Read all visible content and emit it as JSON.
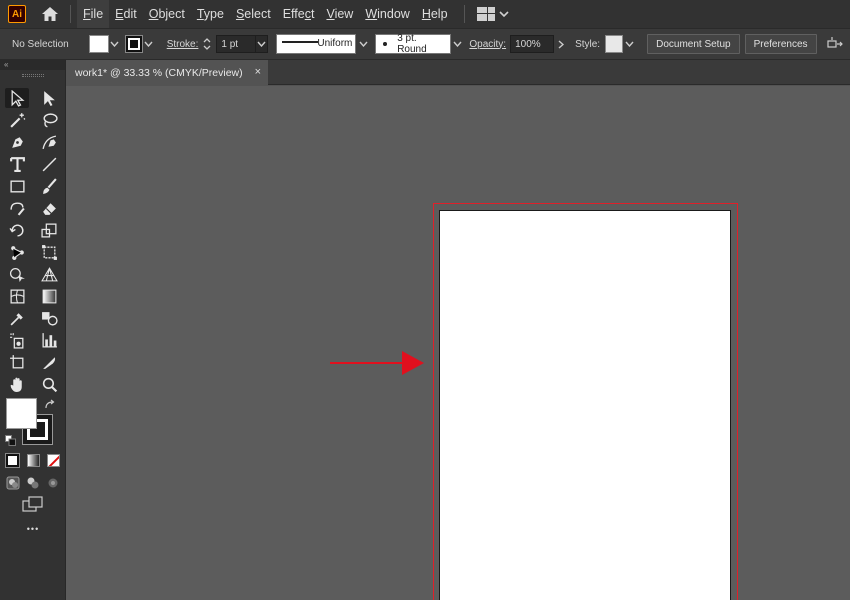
{
  "app": {
    "logo": "Ai",
    "brand_color": "#ff9a00"
  },
  "menu": {
    "items": [
      {
        "key": "F",
        "rest": "ile"
      },
      {
        "key": "E",
        "rest": "dit"
      },
      {
        "key": "O",
        "rest": "bject"
      },
      {
        "key": "T",
        "rest": "ype"
      },
      {
        "key": "S",
        "rest": "elect"
      },
      {
        "key": "",
        "rest": "Effe",
        "key2": "c",
        "rest2": "t"
      },
      {
        "key": "V",
        "rest": "iew"
      },
      {
        "key": "W",
        "rest": "indow"
      },
      {
        "key": "H",
        "rest": "elp"
      }
    ]
  },
  "control": {
    "selection": "No Selection",
    "stroke_label": "Stroke:",
    "stroke_weight": "1 pt",
    "profile": "Uniform",
    "brush": "3 pt. Round",
    "opacity_label": "Opacity:",
    "opacity_value": "100%",
    "style_label": "Style:",
    "document_setup": "Document Setup",
    "preferences": "Preferences"
  },
  "document": {
    "tab_title": "work1* @ 33.33 % (CMYK/Preview)",
    "close_glyph": "×"
  },
  "tools": {
    "panel_collapse": "«",
    "more": "•••"
  },
  "annotation": {
    "arrow_color": "#e0101e",
    "bleed_color": "#e0202a"
  }
}
